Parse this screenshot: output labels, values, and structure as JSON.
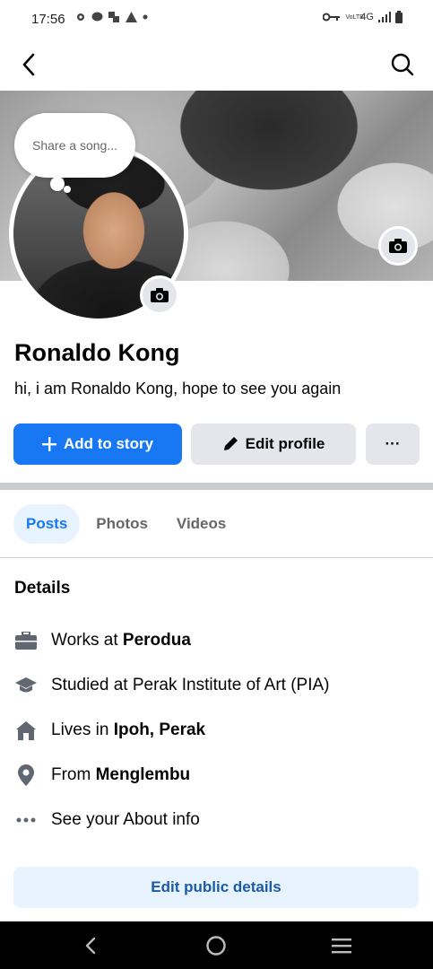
{
  "status_bar": {
    "time": "17:56",
    "network": "4G",
    "volte": "VoLTE"
  },
  "profile": {
    "name": "Ronaldo Kong",
    "bio": "hi, i am Ronaldo Kong, hope to see you again",
    "song_prompt": "Share a song..."
  },
  "actions": {
    "add_story": "Add to story",
    "edit_profile": "Edit profile",
    "more": "···"
  },
  "tabs": [
    {
      "label": "Posts",
      "active": true
    },
    {
      "label": "Photos",
      "active": false
    },
    {
      "label": "Videos",
      "active": false
    }
  ],
  "details": {
    "title": "Details",
    "items": [
      {
        "icon": "briefcase-icon",
        "prefix": "Works at ",
        "bold": "Perodua"
      },
      {
        "icon": "graduation-cap-icon",
        "prefix": "Studied at Perak Institute of Art (PIA)",
        "bold": ""
      },
      {
        "icon": "home-icon",
        "prefix": "Lives in ",
        "bold": "Ipoh, Perak"
      },
      {
        "icon": "location-pin-icon",
        "prefix": "From ",
        "bold": "Menglembu"
      },
      {
        "icon": "more-dots-icon",
        "prefix": "See your About info",
        "bold": ""
      }
    ],
    "edit_public": "Edit public details"
  },
  "colors": {
    "brand": "#1877f2",
    "secondary_bg": "#e4e6eb",
    "light_blue_bg": "#e7f3ff",
    "muted_text": "#65676b",
    "icon_gray": "#606770"
  }
}
